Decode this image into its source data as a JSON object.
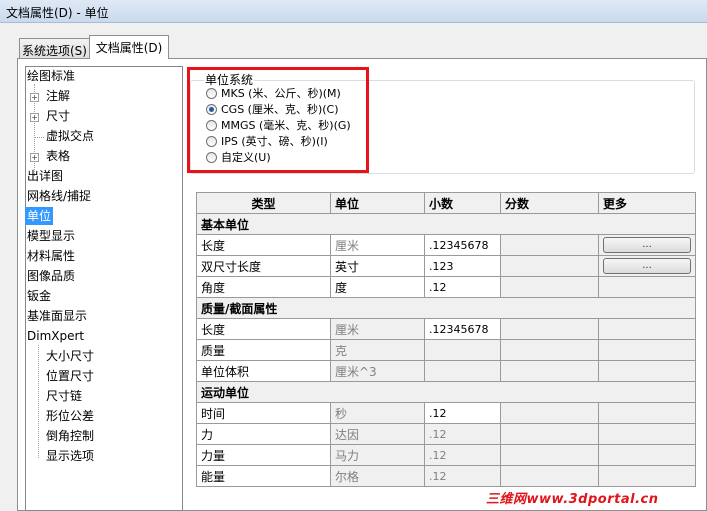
{
  "window": {
    "title": "文档属性(D) - 单位"
  },
  "tabs": [
    {
      "label": "系统选项(S)",
      "active": false
    },
    {
      "label": "文档属性(D)",
      "active": true
    }
  ],
  "tree": {
    "items": [
      {
        "label": "绘图标准"
      },
      {
        "label": "注解"
      },
      {
        "label": "尺寸"
      },
      {
        "label": "虚拟交点"
      },
      {
        "label": "表格"
      },
      {
        "label": "出详图"
      },
      {
        "label": "网格线/捕捉"
      },
      {
        "label": "单位",
        "selected": true
      },
      {
        "label": "模型显示"
      },
      {
        "label": "材料属性"
      },
      {
        "label": "图像品质"
      },
      {
        "label": "钣金"
      },
      {
        "label": "基准面显示"
      },
      {
        "label": "DimXpert"
      },
      {
        "label": "大小尺寸"
      },
      {
        "label": "位置尺寸"
      },
      {
        "label": "尺寸链"
      },
      {
        "label": "形位公差"
      },
      {
        "label": "倒角控制"
      },
      {
        "label": "显示选项"
      }
    ]
  },
  "unit_system": {
    "title": "单位系统",
    "selected": "CGS (厘米、克、秒)(C)",
    "options": [
      "MKS (米、公斤、秒)(M)",
      "CGS (厘米、克、秒)(C)",
      "MMGS (毫米、克、秒)(G)",
      "IPS (英寸、磅、秒)(I)",
      "自定义(U)"
    ]
  },
  "table": {
    "headers": [
      "类型",
      "单位",
      "小数",
      "分数",
      "更多"
    ],
    "sections": [
      {
        "title": "基本单位",
        "rows": [
          {
            "type": "长度",
            "unit": "厘米",
            "decimal": ".12345678",
            "more": "..."
          },
          {
            "type": "双尺寸长度",
            "unit": "英寸",
            "decimal": ".123",
            "more": "..."
          },
          {
            "type": "角度",
            "unit": "度",
            "decimal": ".12"
          }
        ]
      },
      {
        "title": "质量/截面属性",
        "rows": [
          {
            "type": "长度",
            "unit": "厘米",
            "decimal": ".12345678"
          },
          {
            "type": "质量",
            "unit": "克",
            "decimal": ""
          },
          {
            "type": "单位体积",
            "unit": "厘米^3",
            "decimal": ""
          }
        ]
      },
      {
        "title": "运动单位",
        "rows": [
          {
            "type": "时间",
            "unit": "秒",
            "decimal": ".12"
          },
          {
            "type": "力",
            "unit": "达因",
            "decimal": ".12"
          },
          {
            "type": "力量",
            "unit": "马力",
            "decimal": ".12"
          },
          {
            "type": "能量",
            "unit": "尔格",
            "decimal": ".12"
          }
        ]
      }
    ]
  },
  "watermark": "三维网www.3dportal.cn",
  "colors": {
    "highlight_box": "#e8121a",
    "selection": "#3399ff"
  }
}
